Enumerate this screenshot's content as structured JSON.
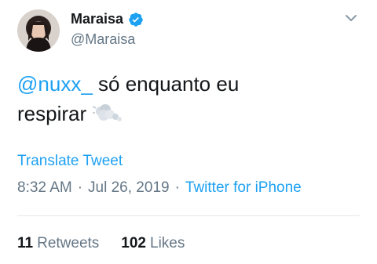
{
  "user": {
    "display_name": "Maraisa",
    "handle": "@Maraisa",
    "verified_icon": "verified-badge-icon",
    "avatar_icon": "avatar"
  },
  "tweet": {
    "mention": "@nuxx_",
    "text_after_mention": " só enquanto eu",
    "text_line2": "respirar",
    "emoji_icon": "dashing-away-emoji"
  },
  "translate_label": "Translate Tweet",
  "meta": {
    "time": "8:32 AM",
    "separator": "·",
    "date": "Jul 26, 2019",
    "source": "Twitter for iPhone"
  },
  "stats": {
    "retweets_count": "11",
    "retweets_label": "Retweets",
    "likes_count": "102",
    "likes_label": "Likes"
  },
  "colors": {
    "link": "#1da1f2",
    "secondary": "#657786",
    "primary": "#14171a",
    "divider": "#e1e8ed"
  }
}
